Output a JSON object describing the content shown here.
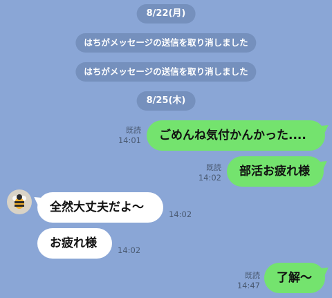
{
  "date_1": "8/22(月)",
  "system_msg_1": "はちがメッセージの送信を取り消しました",
  "system_msg_2": "はちがメッセージの送信を取り消しました",
  "date_2": "8/25(木)",
  "messages": [
    {
      "text": "ごめんね気付かんかった....",
      "read": "既読",
      "time": "14:01",
      "side": "outgoing"
    },
    {
      "text": "部活お疲れ様",
      "read": "既読",
      "time": "14:02",
      "side": "outgoing"
    },
    {
      "text": "全然大丈夫だよ〜",
      "time": "14:02",
      "side": "incoming"
    },
    {
      "text": "お疲れ様",
      "time": "14:02",
      "side": "incoming"
    },
    {
      "text": "了解〜",
      "read": "既読",
      "time": "14:47",
      "side": "outgoing"
    }
  ],
  "avatar_icon": "bee-icon",
  "colors": {
    "background": "#8aa6d6",
    "outgoing_bubble": "#74e36e",
    "incoming_bubble": "#ffffff",
    "system_pill": "#7590bd"
  }
}
